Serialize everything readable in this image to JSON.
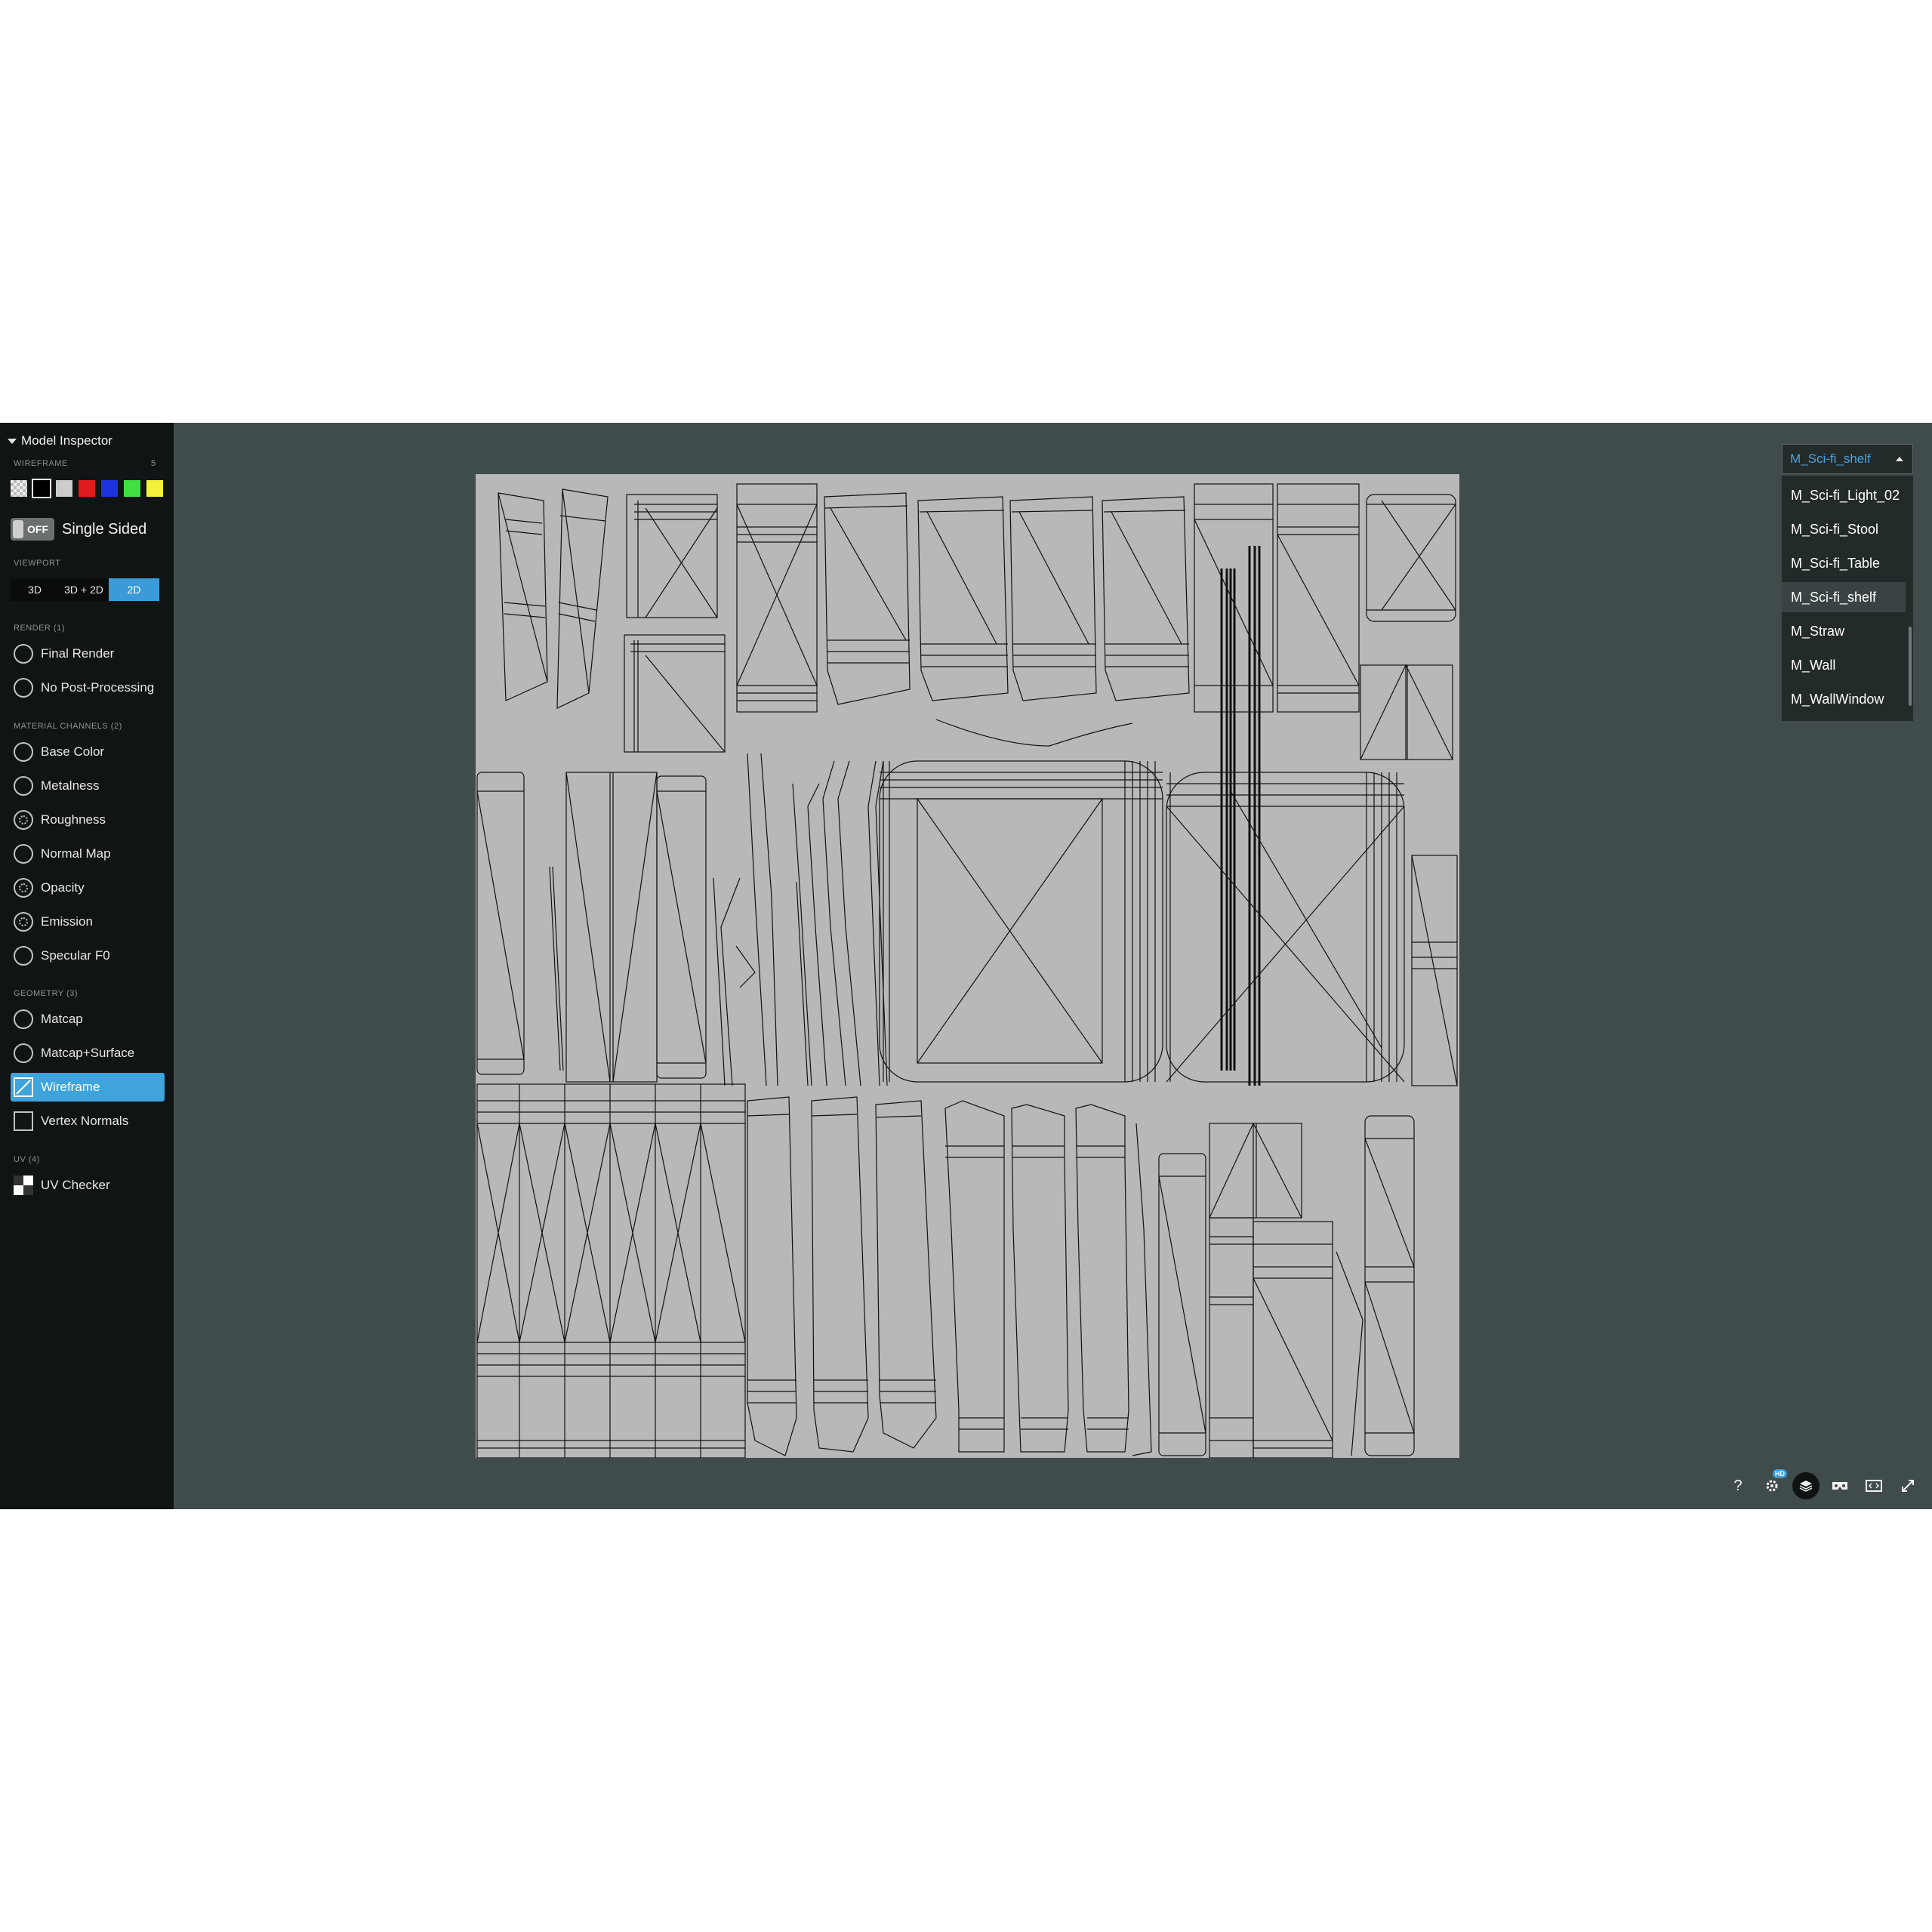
{
  "sidebar": {
    "title": "Model Inspector",
    "wireframe_label": "WIREFRAME",
    "wireframe_count": "5",
    "wireframe_colors": [
      "checker",
      "#000000",
      "#cccccc",
      "#e01b1b",
      "#1b34e0",
      "#3fe03f",
      "#f2f23a"
    ],
    "single_sided": {
      "toggle": "OFF",
      "label": "Single Sided"
    },
    "viewport_label": "VIEWPORT",
    "viewport_buttons": [
      "3D",
      "3D + 2D",
      "2D"
    ],
    "viewport_active": "2D",
    "render_label": "RENDER (1)",
    "render_items": [
      "Final Render",
      "No Post-Processing"
    ],
    "material_label": "MATERIAL CHANNELS (2)",
    "material_items": [
      "Base Color",
      "Metalness",
      "Roughness",
      "Normal Map",
      "Opacity",
      "Emission",
      "Specular F0"
    ],
    "geometry_label": "GEOMETRY (3)",
    "geometry_items": [
      "Matcap",
      "Matcap+Surface",
      "Wireframe",
      "Vertex Normals"
    ],
    "geometry_active": "Wireframe",
    "uv_label": "UV (4)",
    "uv_items": [
      "UV Checker"
    ]
  },
  "material_select": {
    "selected": "M_Sci-fi_shelf",
    "options": [
      "M_Sci-fi_Light_02",
      "M_Sci-fi_Stool",
      "M_Sci-fi_Table",
      "M_Sci-fi_shelf",
      "M_Straw",
      "M_Wall",
      "M_WallWindow"
    ]
  },
  "toolbar": {
    "help": "?",
    "settings_badge": "HD",
    "icons": [
      "help-icon",
      "settings-icon",
      "layers-icon",
      "vr-icon",
      "embed-icon",
      "fullscreen-icon"
    ]
  },
  "colors": {
    "viewer_bg": "#404b4b",
    "sidebar_bg": "#111414",
    "accent": "#3fa3dc",
    "uv_bg": "#b7b8b8"
  }
}
